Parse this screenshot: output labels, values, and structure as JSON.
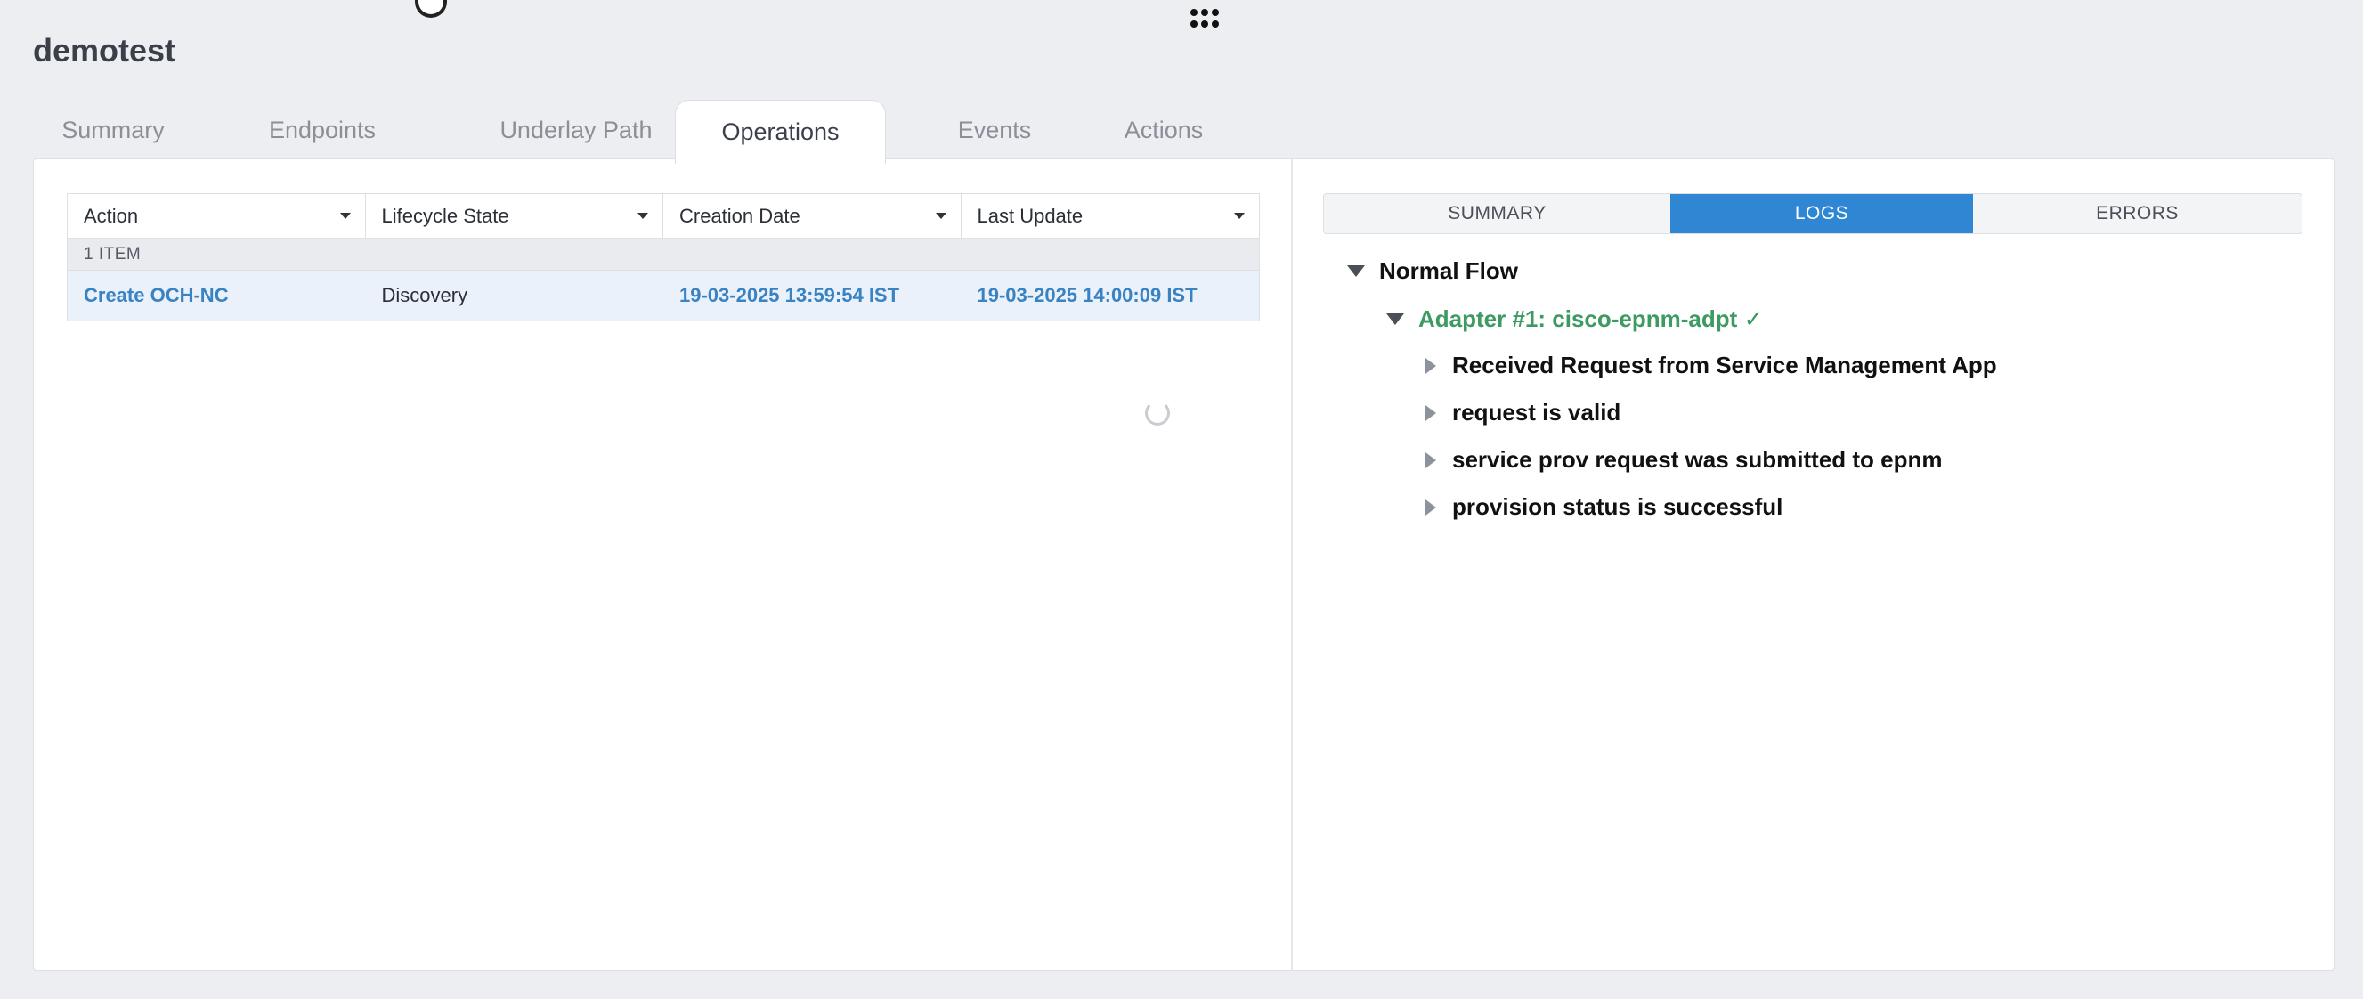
{
  "header": {
    "title": "demotest"
  },
  "tabs": [
    {
      "label": "Summary"
    },
    {
      "label": "Endpoints"
    },
    {
      "label": "Underlay Path"
    },
    {
      "label": "Operations",
      "active": true
    },
    {
      "label": "Events"
    },
    {
      "label": "Actions"
    }
  ],
  "table": {
    "columns": [
      "Action",
      "Lifecycle State",
      "Creation Date",
      "Last Update"
    ],
    "count_label": "1 ITEM",
    "rows": [
      {
        "action": "Create OCH-NC",
        "state": "Discovery",
        "created": "19-03-2025 13:59:54 IST",
        "updated": "19-03-2025 14:00:09 IST"
      }
    ]
  },
  "detail_tabs": [
    {
      "label": "SUMMARY"
    },
    {
      "label": "LOGS",
      "active": true
    },
    {
      "label": "ERRORS"
    }
  ],
  "log_tree": {
    "root": "Normal Flow",
    "adapter": "Adapter #1: cisco-epnm-adpt ✓",
    "steps": [
      "Received Request from Service Management App",
      "request is valid",
      "service prov request was submitted to epnm",
      "provision status is successful"
    ]
  },
  "colors": {
    "accent": "#2f86d3",
    "link": "#3a83c3",
    "success": "#3c9a62"
  },
  "icons": [
    "app-grid-icon",
    "loading-spinner-icon",
    "collapse-triangle-icon",
    "expand-triangle-icon",
    "sort-caret-icon"
  ]
}
